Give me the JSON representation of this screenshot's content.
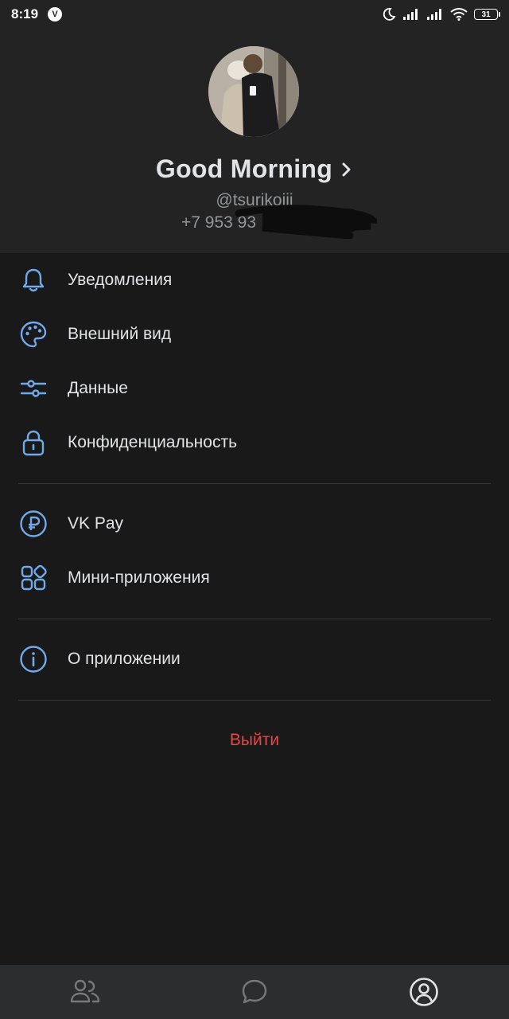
{
  "status_bar": {
    "time": "8:19",
    "app_badge": "V",
    "battery": "31",
    "icons": [
      "moon-icon",
      "signal-icon",
      "signal-icon",
      "wifi-icon",
      "battery-icon"
    ]
  },
  "profile": {
    "name": "Good Morning",
    "username": "@tsurikojii",
    "phone": "+7 953 93"
  },
  "menu": {
    "group1": [
      {
        "label": "Уведомления",
        "icon": "bell-icon"
      },
      {
        "label": "Внешний вид",
        "icon": "palette-icon"
      },
      {
        "label": "Данные",
        "icon": "sliders-icon"
      },
      {
        "label": "Конфиденциальность",
        "icon": "lock-icon"
      }
    ],
    "group2": [
      {
        "label": "VK Pay",
        "icon": "ruble-icon"
      },
      {
        "label": "Мини-приложения",
        "icon": "apps-grid-icon"
      }
    ],
    "group3": [
      {
        "label": "О приложении",
        "icon": "info-icon"
      }
    ]
  },
  "logout_label": "Выйти",
  "tab_bar": {
    "tabs": [
      {
        "icon": "friends-icon",
        "active": false
      },
      {
        "icon": "chat-icon",
        "active": false
      },
      {
        "icon": "profile-icon",
        "active": true
      }
    ]
  },
  "colors": {
    "background": "#19191a",
    "header": "#232324",
    "accent": "#71aaeb",
    "danger": "#e64646",
    "text": "#e1e3e6",
    "secondary_text": "#939699"
  }
}
